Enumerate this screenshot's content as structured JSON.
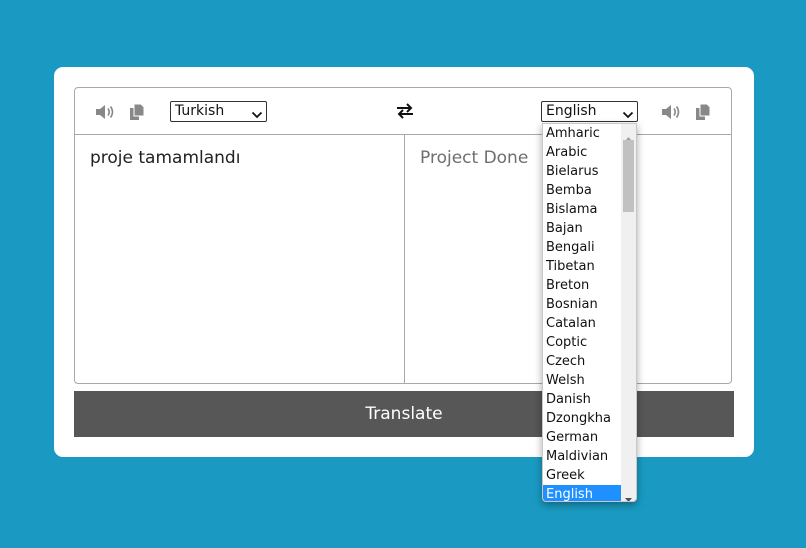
{
  "from": {
    "language": "Turkish",
    "text": "proje tamamlandı"
  },
  "to": {
    "language": "English",
    "text": "Project Done"
  },
  "translate_label": "Translate",
  "icons": [
    "speaker-icon",
    "copy-icon",
    "exchange-icon",
    "chevron-down-icon"
  ],
  "colors": {
    "background": "#1a9ac2",
    "button": "#575757",
    "selected": "#1e90ff",
    "placeholder_text": "#6e6e6e"
  },
  "dropdown_options": [
    "Amharic",
    "Arabic",
    "Bielarus",
    "Bemba",
    "Bislama",
    "Bajan",
    "Bengali",
    "Tibetan",
    "Breton",
    "Bosnian",
    "Catalan",
    "Coptic",
    "Czech",
    "Welsh",
    "Danish",
    "Dzongkha",
    "German",
    "Maldivian",
    "Greek",
    "English"
  ],
  "dropdown_selected": "English"
}
